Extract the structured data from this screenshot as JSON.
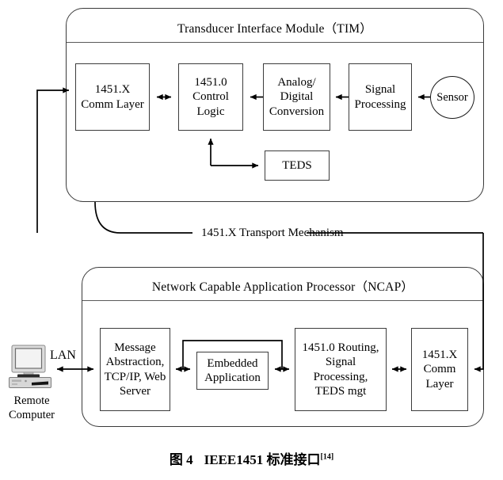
{
  "figure": {
    "caption_prefix": "图 4",
    "caption_title": "IEEE1451 标准接口",
    "caption_ref": "[14]"
  },
  "tim": {
    "title": "Transducer Interface Module（TIM）",
    "blocks": [
      {
        "id": "tim-comm-layer",
        "lines": [
          "1451.X",
          "Comm Layer"
        ]
      },
      {
        "id": "tim-control-logic",
        "lines": [
          "1451.0",
          "Control",
          "Logic"
        ]
      },
      {
        "id": "tim-adc",
        "lines": [
          "Analog/",
          "Digital",
          "Conversion"
        ]
      },
      {
        "id": "tim-signal-processing",
        "lines": [
          "Signal",
          "Processing"
        ]
      },
      {
        "id": "tim-teds",
        "lines": [
          "TEDS"
        ]
      }
    ],
    "sensor": "Sensor"
  },
  "transport": {
    "label": "1451.X Transport Mechanism"
  },
  "ncap": {
    "title": "Network Capable Application Processor（NCAP）",
    "blocks": [
      {
        "id": "ncap-message-abstraction",
        "lines": [
          "Message",
          "Abstraction,",
          "TCP/IP, Web",
          "Server"
        ]
      },
      {
        "id": "ncap-embedded-application",
        "lines": [
          "Embedded",
          "Application"
        ]
      },
      {
        "id": "ncap-routing",
        "lines": [
          "1451.0 Routing,",
          "Signal",
          "Processing,",
          "TEDS mgt"
        ]
      },
      {
        "id": "ncap-comm-layer",
        "lines": [
          "1451.X",
          "Comm",
          "Layer"
        ]
      }
    ]
  },
  "remote": {
    "lan_label": "LAN",
    "computer_label_line1": "Remote",
    "computer_label_line2": "Computer",
    "icon": "desktop-computer-icon"
  },
  "colors": {
    "line": "#000000",
    "block_border": "#3c3c3c",
    "group_border": "#3a3a3a",
    "background": "#ffffff",
    "text": "#000000"
  }
}
